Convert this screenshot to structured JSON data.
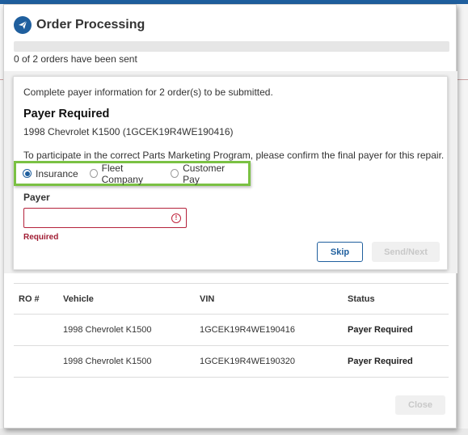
{
  "dialog": {
    "title": "Order Processing",
    "progress_percent": 0,
    "progress_text": "0 of 2 orders have been sent"
  },
  "payer_form": {
    "complete_message": "Complete payer information for 2 order(s) to be submitted.",
    "heading": "Payer Required",
    "vehicle": "1998 Chevrolet K1500 (1GCEK19R4WE190416)",
    "participate_message": "To participate in the correct Parts Marketing Program, please confirm the final payer for this repair.",
    "options": [
      {
        "label": "Insurance",
        "selected": true
      },
      {
        "label": "Fleet Company",
        "selected": false
      },
      {
        "label": "Customer Pay",
        "selected": false
      }
    ],
    "payer_label": "Payer",
    "payer_value": "",
    "error_icon": "!",
    "required_text": "Required",
    "skip_label": "Skip",
    "send_label": "Send/Next"
  },
  "table": {
    "headers": {
      "ro": "RO #",
      "vehicle": "Vehicle",
      "vin": "VIN",
      "status": "Status"
    },
    "rows": [
      {
        "ro": "",
        "vehicle": "1998 Chevrolet K1500",
        "vin": "1GCEK19R4WE190416",
        "status": "Payer Required"
      },
      {
        "ro": "",
        "vehicle": "1998 Chevrolet K1500",
        "vin": "1GCEK19R4WE190320",
        "status": "Payer Required"
      }
    ]
  },
  "footer": {
    "close_label": "Close"
  },
  "colors": {
    "accent": "#1f5f9e",
    "error": "#b4223b",
    "highlight": "#7ac143"
  },
  "icons": {
    "logo": "paper-plane-icon"
  }
}
